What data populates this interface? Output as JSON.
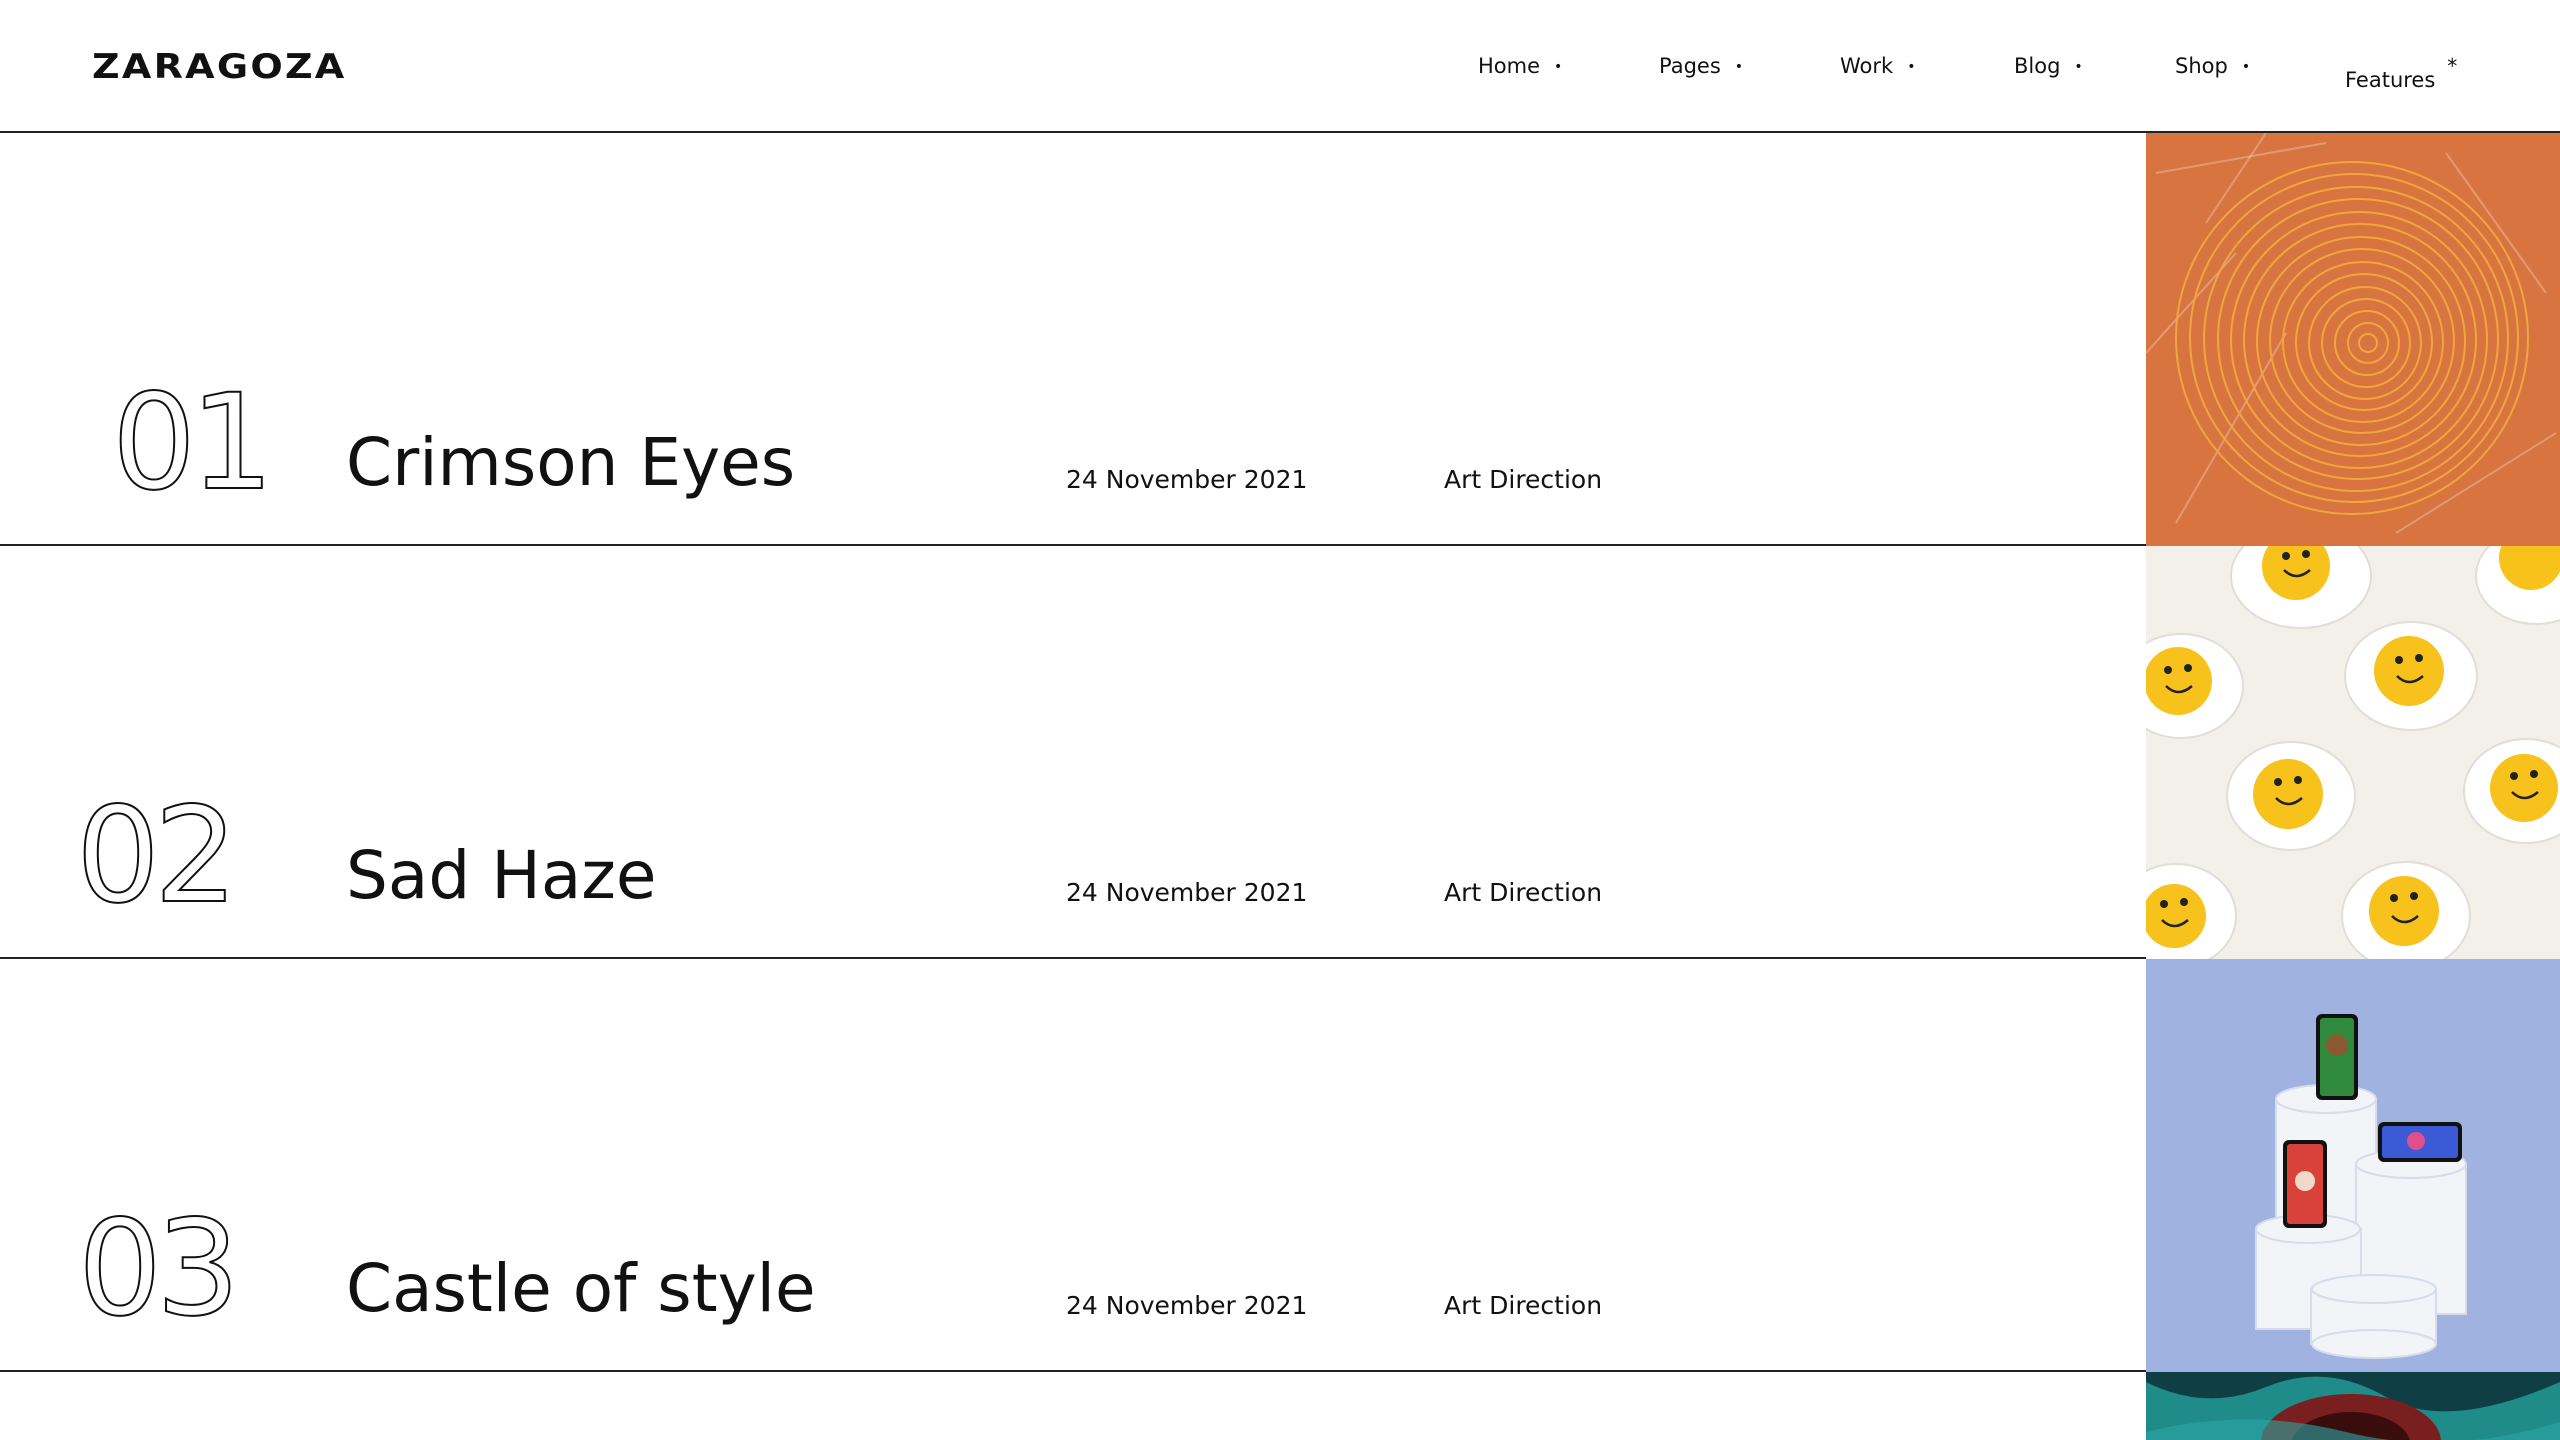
{
  "brand": {
    "logo": "ZARAGOZA"
  },
  "nav": {
    "items": [
      {
        "label": "Home",
        "marker": "•"
      },
      {
        "label": "Pages",
        "marker": "•"
      },
      {
        "label": "Work",
        "marker": "•"
      },
      {
        "label": "Blog",
        "marker": "•"
      },
      {
        "label": "Shop",
        "marker": "•"
      },
      {
        "label": "Features",
        "marker": "*"
      }
    ]
  },
  "projects": [
    {
      "number": "01",
      "title": "Crimson Eyes",
      "date": "24 November 2021",
      "category": "Art Direction",
      "image": "orange-spiral-image"
    },
    {
      "number": "02",
      "title": "Sad Haze",
      "date": "24 November 2021",
      "category": "Art Direction",
      "image": "smiley-eggs-image"
    },
    {
      "number": "03",
      "title": "Castle of style",
      "date": "24 November 2021",
      "category": "Art Direction",
      "image": "phones-on-pedestals-image"
    }
  ],
  "colors": {
    "text": "#111111",
    "divider": "#222222",
    "thumb_orange": "#d8743f",
    "thumb_spiral": "#f0a63c",
    "thumb_egg_bg": "#f3efe9",
    "thumb_yolk": "#f7c21b",
    "thumb_blue": "#9fb2e0",
    "thumb_teal": "#1f8c8a"
  }
}
